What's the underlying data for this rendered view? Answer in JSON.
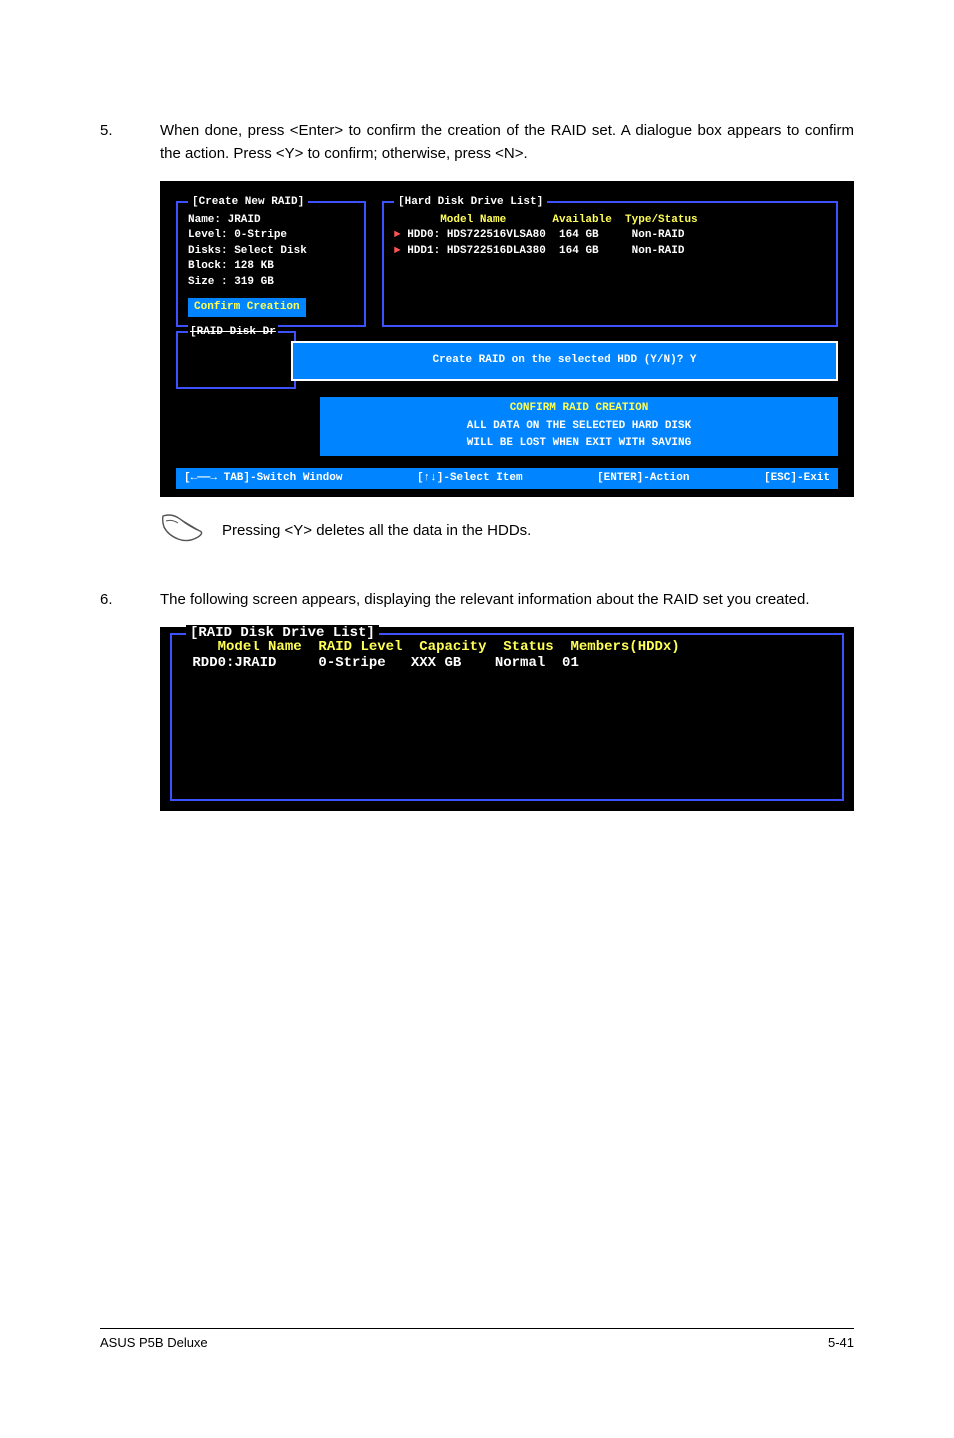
{
  "step5": {
    "num": "5.",
    "text": "When done, press <Enter> to confirm the creation of the RAID set. A dialogue box appears to confirm the action. Press <Y> to confirm; otherwise, press <N>."
  },
  "term1": {
    "create_title": "[Create New RAID]",
    "hdd_title": "[Hard Disk Drive List]",
    "left_lines": {
      "l0": "Name: JRAID",
      "l1": "Level: 0-Stripe",
      "l2": "Disks: Select Disk",
      "l3": "Block: 128 KB",
      "l4": "Size : 319 GB"
    },
    "confirm_btn": "Confirm Creation",
    "hdd_header": "       Model Name       Available  Type/Status",
    "hdd_rows": {
      "r0": " HDD0: HDS722516VLSA80  164 GB     Non-RAID",
      "r1": " HDD1: HDS722516DLA380  164 GB     Non-RAID"
    },
    "raid_dr_label": "[RAID Disk Dr",
    "popup_yn": "Create RAID on the selected HDD (Y/N)? Y",
    "pill1_title": "CONFIRM RAID CREATION",
    "pill2_msg1": "ALL DATA ON THE SELECTED HARD DISK",
    "pill2_msg2": "WILL BE LOST WHEN EXIT WITH SAVING",
    "footer": {
      "a": "[←――→ TAB]-Switch Window",
      "b": "[↑↓]-Select Item",
      "c": "[ENTER]-Action",
      "d": "[ESC]-Exit"
    }
  },
  "note": "Pressing <Y> deletes all the data in the HDDs.",
  "step6": {
    "num": "6.",
    "text": "The following screen appears, displaying the relevant information about the RAID set you created."
  },
  "term2": {
    "title": "[RAID Disk Drive List]",
    "hdr_model": "Model Name ",
    "hdr_raid": " RAID Level ",
    "hdr_cap": " Capacity ",
    "hdr_status": " Status ",
    "hdr_members": " Members(HDDx)",
    "row": " RDD0:JRAID     0-Stripe   XXX GB    Normal  01"
  },
  "footer": {
    "left": "ASUS P5B Deluxe",
    "right": "5-41"
  }
}
